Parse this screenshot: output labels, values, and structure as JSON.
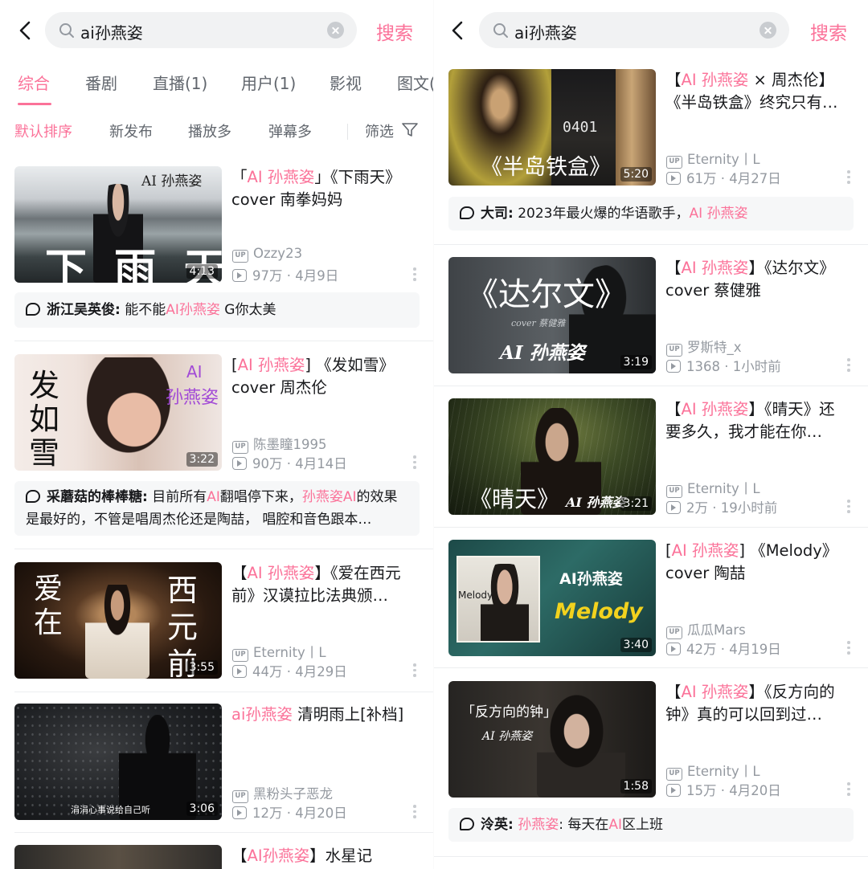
{
  "search": {
    "query": "ai孙燕姿",
    "button": "搜索"
  },
  "tabs": [
    "综合",
    "番剧",
    "直播(1)",
    "用户(1)",
    "影视",
    "图文("
  ],
  "sort": [
    "默认排序",
    "新发布",
    "播放多",
    "弹幕多"
  ],
  "filter_label": "筛选",
  "colors": {
    "accent": "#fb7299",
    "text": "#18191c",
    "secondary": "#9499a0"
  },
  "left_videos": [
    {
      "title_pre": "「",
      "title_hl": "AI 孙燕姿",
      "title_post": "」《下雨天》cover 南拳妈妈",
      "thumb_logo": "AI 孙燕姿",
      "thumb_text": "下 雨 天",
      "duration": "4:13",
      "uploader": "Ozzy23",
      "views": "97万",
      "date": "4月9日"
    },
    {
      "title_pre": "[",
      "title_hl": "AI 孙燕姿",
      "title_post": "] 《发如雪》cover 周杰伦",
      "thumb_text_1": "发",
      "thumb_text_2": "如",
      "thumb_text_3": "雪",
      "thumb_logo_1": "AI",
      "thumb_logo_2": "孙燕姿",
      "duration": "3:22",
      "uploader": "陈墨瞳1995",
      "views": "90万",
      "date": "4月14日"
    },
    {
      "title_pre": "【",
      "title_hl": "AI 孙燕姿",
      "title_post": "】《爱在西元前》汉谟拉比法典颁…",
      "thumb_text_1": "爱",
      "thumb_text_2": "在",
      "thumb_text_3": "西",
      "thumb_text_4": "元",
      "thumb_text_5": "前",
      "duration": "3:55",
      "uploader": "Eternity丨L",
      "views": "44万",
      "date": "4月29日"
    },
    {
      "title_pre": "",
      "title_hl": "ai孙燕姿",
      "title_post": " 清明雨上[补档]",
      "thumb_caption": "涓涓心事说给自己听",
      "duration": "3:06",
      "uploader": "黑粉头子恶龙",
      "views": "12万",
      "date": "4月20日"
    },
    {
      "title_pre": "【",
      "title_hl": "AI孙燕姿",
      "title_post": "】水星记"
    }
  ],
  "left_comments": [
    {
      "user": "浙江吴英俊:",
      "pre": " 能不能",
      "hl": "AI孙燕姿",
      "post": " G你太美"
    },
    {
      "user": "采蘑菇的棒棒糖:",
      "text_1": " 目前所有",
      "hl_1": "AI",
      "text_2": "翻唱停下来，",
      "hl_2": "孙燕姿AI",
      "text_3": "的效果是最好的，不管是唱周杰伦还是陶喆， 唱腔和音色跟本…"
    }
  ],
  "right_videos": [
    {
      "title_pre": "【",
      "title_hl": "AI 孙燕姿",
      "title_post": " × 周杰伦】《半岛铁盒》终究只有…",
      "thumb_text": "《半岛铁盒》",
      "thumb_num": "0401",
      "duration": "5:20",
      "uploader": "Eternity丨L",
      "views": "61万",
      "date": "4月27日"
    },
    {
      "title_pre": "【",
      "title_hl": "AI 孙燕姿",
      "title_post": "】《达尔文》cover 蔡健雅",
      "thumb_text": "《达尔文》",
      "thumb_sub": "cover 蔡健雅",
      "thumb_logo": "AI 孙燕姿",
      "duration": "3:19",
      "uploader": "罗斯特_x",
      "views": "1368",
      "date": "1小时前"
    },
    {
      "title_pre": "【",
      "title_hl": "AI 孙燕姿",
      "title_post": "】《晴天》还要多久，我才能在你…",
      "thumb_text": "《晴天》",
      "thumb_logo": "AI 孙燕姿",
      "duration": "3:21",
      "uploader": "Eternity丨L",
      "views": "2万",
      "date": "19小时前"
    },
    {
      "title_pre": "[",
      "title_hl": "AI 孙燕姿",
      "title_post": "] 《Melody》cover 陶喆",
      "thumb_logo": "AI孙燕姿",
      "thumb_text": "Melody",
      "thumb_small": "Melody",
      "duration": "3:40",
      "uploader": "瓜瓜Mars",
      "views": "42万",
      "date": "4月19日"
    },
    {
      "title_pre": "【",
      "title_hl": "AI 孙燕姿",
      "title_post": "】《反方向的钟》真的可以回到过…",
      "thumb_text": "「反方向的钟」",
      "thumb_logo": "AI 孙燕姿",
      "duration": "1:58",
      "uploader": "Eternity丨L",
      "views": "15万",
      "date": "4月20日"
    }
  ],
  "right_comments": [
    {
      "user": "大司:",
      "pre": " 2023年最火爆的华语歌手，",
      "hl": "AI 孙燕姿",
      "post": ""
    },
    {
      "user": "泠英:",
      "pre": " ",
      "hl": "孙燕姿",
      "post": ":  每天在",
      "hl_2": "AI",
      "post_2": "区上班"
    }
  ]
}
